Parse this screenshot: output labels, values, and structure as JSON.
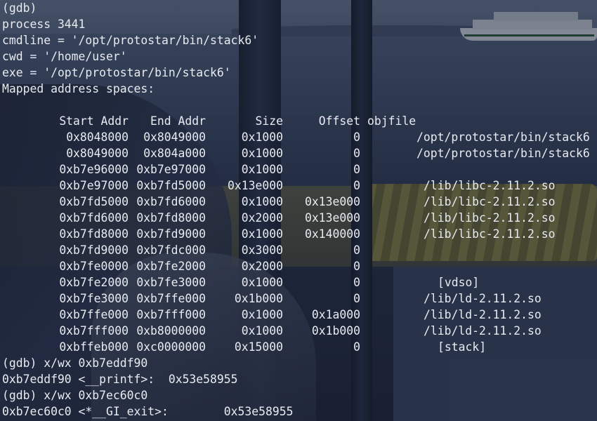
{
  "terminal": {
    "gdb_prompt": "(gdb)",
    "process_line": "process 3441",
    "cmdline_line": "cmdline = '/opt/protostar/bin/stack6'",
    "cwd_line": "cwd = '/home/user'",
    "exe_line": "exe = '/opt/protostar/bin/stack6'",
    "mapped_header": "Mapped address spaces:"
  },
  "table": {
    "headers": {
      "start": "Start Addr",
      "end": "End Addr",
      "size": "Size",
      "offset": "Offset",
      "objfile": "objfile"
    },
    "rows": [
      {
        "start": "0x8048000",
        "end": "0x8049000",
        "size": "0x1000",
        "offset": "0",
        "objfile": "/opt/protostar/bin/stack6"
      },
      {
        "start": "0x8049000",
        "end": "0x804a000",
        "size": "0x1000",
        "offset": "0",
        "objfile": "/opt/protostar/bin/stack6"
      },
      {
        "start": "0xb7e96000",
        "end": "0xb7e97000",
        "size": "0x1000",
        "offset": "0",
        "objfile": ""
      },
      {
        "start": "0xb7e97000",
        "end": "0xb7fd5000",
        "size": "0x13e000",
        "offset": "0",
        "objfile": "/lib/libc-2.11.2.so"
      },
      {
        "start": "0xb7fd5000",
        "end": "0xb7fd6000",
        "size": "0x1000",
        "offset": "0x13e000",
        "objfile": "/lib/libc-2.11.2.so"
      },
      {
        "start": "0xb7fd6000",
        "end": "0xb7fd8000",
        "size": "0x2000",
        "offset": "0x13e000",
        "objfile": "/lib/libc-2.11.2.so"
      },
      {
        "start": "0xb7fd8000",
        "end": "0xb7fd9000",
        "size": "0x1000",
        "offset": "0x140000",
        "objfile": "/lib/libc-2.11.2.so"
      },
      {
        "start": "0xb7fd9000",
        "end": "0xb7fdc000",
        "size": "0x3000",
        "offset": "0",
        "objfile": ""
      },
      {
        "start": "0xb7fe0000",
        "end": "0xb7fe2000",
        "size": "0x2000",
        "offset": "0",
        "objfile": ""
      },
      {
        "start": "0xb7fe2000",
        "end": "0xb7fe3000",
        "size": "0x1000",
        "offset": "0",
        "objfile": "[vdso]"
      },
      {
        "start": "0xb7fe3000",
        "end": "0xb7ffe000",
        "size": "0x1b000",
        "offset": "0",
        "objfile": "/lib/ld-2.11.2.so"
      },
      {
        "start": "0xb7ffe000",
        "end": "0xb7fff000",
        "size": "0x1000",
        "offset": "0x1a000",
        "objfile": "/lib/ld-2.11.2.so"
      },
      {
        "start": "0xb7fff000",
        "end": "0xb8000000",
        "size": "0x1000",
        "offset": "0x1b000",
        "objfile": "/lib/ld-2.11.2.so"
      },
      {
        "start": "0xbffeb000",
        "end": "0xc0000000",
        "size": "0x15000",
        "offset": "0",
        "objfile": "[stack]"
      }
    ]
  },
  "commands": [
    {
      "prompt": "(gdb) x/wx 0xb7eddf90",
      "output": "0xb7eddf90 <__printf>:  0x53e58955"
    },
    {
      "prompt": "(gdb) x/wx 0xb7ec60c0",
      "output": "0xb7ec60c0 <*__GI_exit>:        0x53e58955"
    }
  ]
}
